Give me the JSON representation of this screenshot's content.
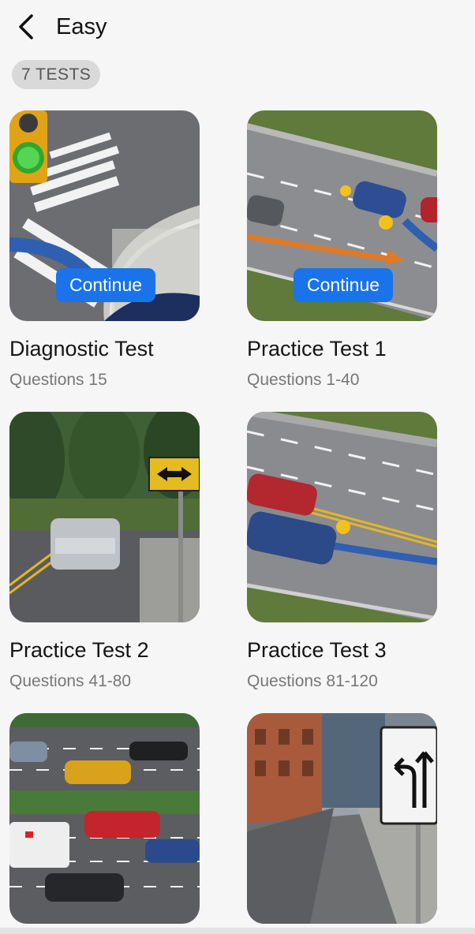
{
  "header": {
    "title": "Easy",
    "back_icon": "chevron-left-icon"
  },
  "badge": "7 TESTS",
  "tests": [
    {
      "name": "Diagnostic Test",
      "questions": "Questions 15",
      "continue": "Continue"
    },
    {
      "name": "Practice Test 1",
      "questions": "Questions 1-40",
      "continue": "Continue"
    },
    {
      "name": "Practice Test 2",
      "questions": "Questions 41-80"
    },
    {
      "name": "Practice Test 3",
      "questions": "Questions 81-120"
    },
    {
      "name": ""
    },
    {
      "name": ""
    }
  ],
  "colors": {
    "accent": "#1a73e8",
    "badge_bg": "#d9d9d9",
    "background": "#f6f6f6"
  }
}
